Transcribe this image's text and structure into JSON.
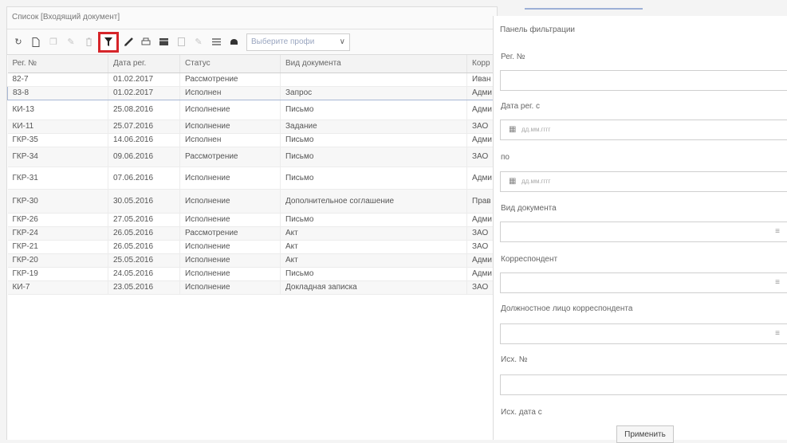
{
  "list": {
    "title": "Список [Входящий документ]",
    "profile_placeholder": "Выберите профи",
    "columns": [
      "Рег. №",
      "Дата рег.",
      "Статус",
      "Вид документа",
      "Корр"
    ],
    "rows": [
      {
        "reg": "82-7",
        "date": "01.02.2017",
        "status": "Рассмотрение",
        "kind": "",
        "corr": "Иван"
      },
      {
        "reg": "83-8",
        "date": "01.02.2017",
        "status": "Исполнен",
        "kind": "Запрос",
        "corr": "Адми"
      },
      {
        "reg": "КИ-13",
        "date": "25.08.2016",
        "status": "Исполнение",
        "kind": "Письмо",
        "corr": "Адми"
      },
      {
        "reg": "КИ-11",
        "date": "25.07.2016",
        "status": "Исполнение",
        "kind": "Задание",
        "corr": "ЗАО"
      },
      {
        "reg": "ГКР-35",
        "date": "14.06.2016",
        "status": "Исполнен",
        "kind": "Письмо",
        "corr": "Адми"
      },
      {
        "reg": "ГКР-34",
        "date": "09.06.2016",
        "status": "Рассмотрение",
        "kind": "Письмо",
        "corr": "ЗАО"
      },
      {
        "reg": "ГКР-31",
        "date": "07.06.2016",
        "status": "Исполнение",
        "kind": "Письмо",
        "corr": "Адми"
      },
      {
        "reg": "ГКР-30",
        "date": "30.05.2016",
        "status": "Исполнение",
        "kind": "Дополнительное соглашение",
        "corr": "Прав"
      },
      {
        "reg": "ГКР-26",
        "date": "27.05.2016",
        "status": "Исполнение",
        "kind": "Письмо",
        "corr": "Адми"
      },
      {
        "reg": "ГКР-24",
        "date": "26.05.2016",
        "status": "Рассмотрение",
        "kind": "Акт",
        "corr": "ЗАО"
      },
      {
        "reg": "ГКР-21",
        "date": "26.05.2016",
        "status": "Исполнение",
        "kind": "Акт",
        "corr": "ЗАО"
      },
      {
        "reg": "ГКР-20",
        "date": "25.05.2016",
        "status": "Исполнение",
        "kind": "Акт",
        "corr": "Адми"
      },
      {
        "reg": "ГКР-19",
        "date": "24.05.2016",
        "status": "Исполнение",
        "kind": "Письмо",
        "corr": "Адми"
      },
      {
        "reg": "КИ-7",
        "date": "23.05.2016",
        "status": "Исполнение",
        "kind": "Докладная записка",
        "corr": "ЗАО"
      }
    ],
    "toolbar_icons": [
      "refresh-icon",
      "new-document-icon",
      "copy-icon",
      "edit-icon",
      "delete-icon",
      "filter-icon",
      "clear-filter-icon",
      "print-icon",
      "table-view-icon",
      "export-icon",
      "attach-icon",
      "list-icon",
      "profile-icon"
    ]
  },
  "filter": {
    "title": "Панель фильтрации",
    "reg_label": "Рег. №",
    "date_from_label": "Дата рег. с",
    "date_to_label": "по",
    "date_placeholder": "дд.мм.гггг",
    "kind_label": "Вид документа",
    "correspondent_label": "Корреспондент",
    "official_label": "Должностное лицо корреспондента",
    "out_no_label": "Исх. №",
    "out_date_label": "Исх. дата с",
    "apply_label": "Применить"
  },
  "colors": {
    "accent_red": "#d6252a",
    "selection_border": "#a8b7d4"
  }
}
